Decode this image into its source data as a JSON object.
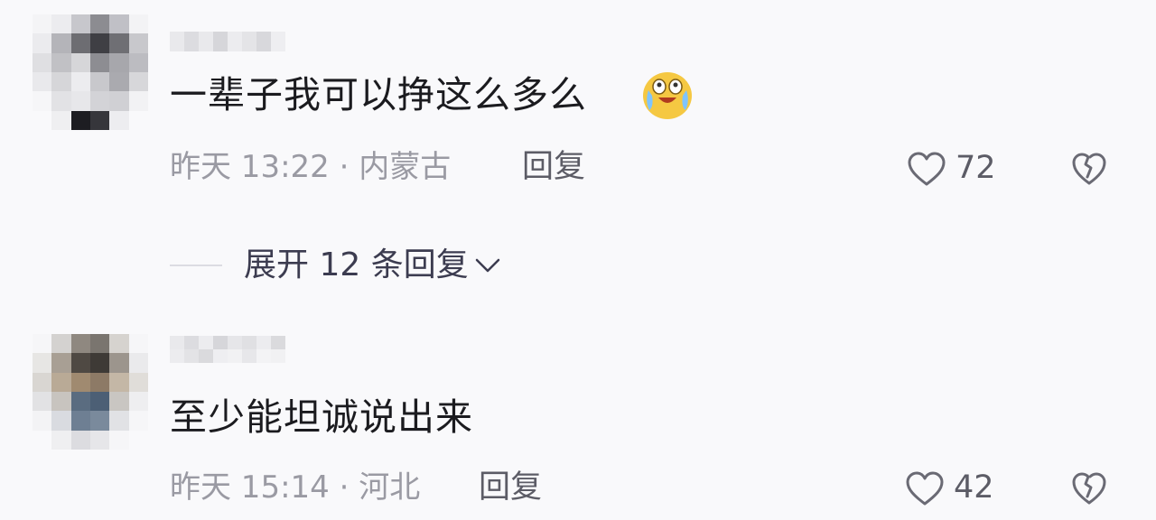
{
  "comments": [
    {
      "text": "一辈子我可以挣这么多么",
      "emoji": "crying-laughing-face",
      "meta": "昨天 13:22 · 内蒙古",
      "reply_label": "回复",
      "likes": "72"
    },
    {
      "text": "至少能坦诚说出来",
      "meta": "昨天 15:14 · 河北",
      "reply_label": "回复",
      "likes": "42"
    }
  ],
  "expand": {
    "label": "展开 12 条回复"
  },
  "colors": {
    "text": "#1b1b1f",
    "meta": "#9a9aa3",
    "action": "#5c5c66"
  }
}
